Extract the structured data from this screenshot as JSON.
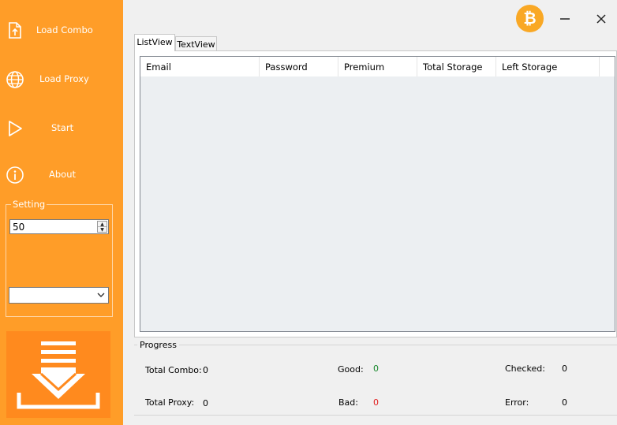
{
  "sidebar": {
    "items": [
      {
        "label": "Load Combo",
        "icon": "file-upload-icon"
      },
      {
        "label": "Load Proxy",
        "icon": "globe-icon"
      },
      {
        "label": "Start",
        "icon": "play-icon"
      },
      {
        "label": "About",
        "icon": "info-icon"
      }
    ],
    "setting": {
      "legend": "Setting",
      "threads_value": "50",
      "dropdown_value": ""
    },
    "download_icon": "download-icon"
  },
  "titlebar": {
    "logo_icon": "bitcoin-icon",
    "logo_glyph": "₿",
    "minimize_icon": "minimize-icon",
    "close_icon": "close-icon"
  },
  "tabs": [
    {
      "label": "ListView",
      "active": true
    },
    {
      "label": "TextView",
      "active": false
    }
  ],
  "listview": {
    "columns": [
      "Email",
      "Password",
      "Premium",
      "Total Storage",
      "Left Storage"
    ],
    "rows": []
  },
  "progress": {
    "legend": "Progress",
    "total_combo": {
      "label": "Total Combo:",
      "value": "0"
    },
    "total_proxy": {
      "label": "Total Proxy:",
      "value": "0"
    },
    "good": {
      "label": "Good:",
      "value": "0"
    },
    "bad": {
      "label": "Bad:",
      "value": "0"
    },
    "checked": {
      "label": "Checked:",
      "value": "0"
    },
    "error": {
      "label": "Error:",
      "value": "0"
    }
  },
  "colors": {
    "sidebar": "#ff9d28",
    "good": "#1a8a2e",
    "bad": "#e02020",
    "coin": "#f9a825"
  }
}
